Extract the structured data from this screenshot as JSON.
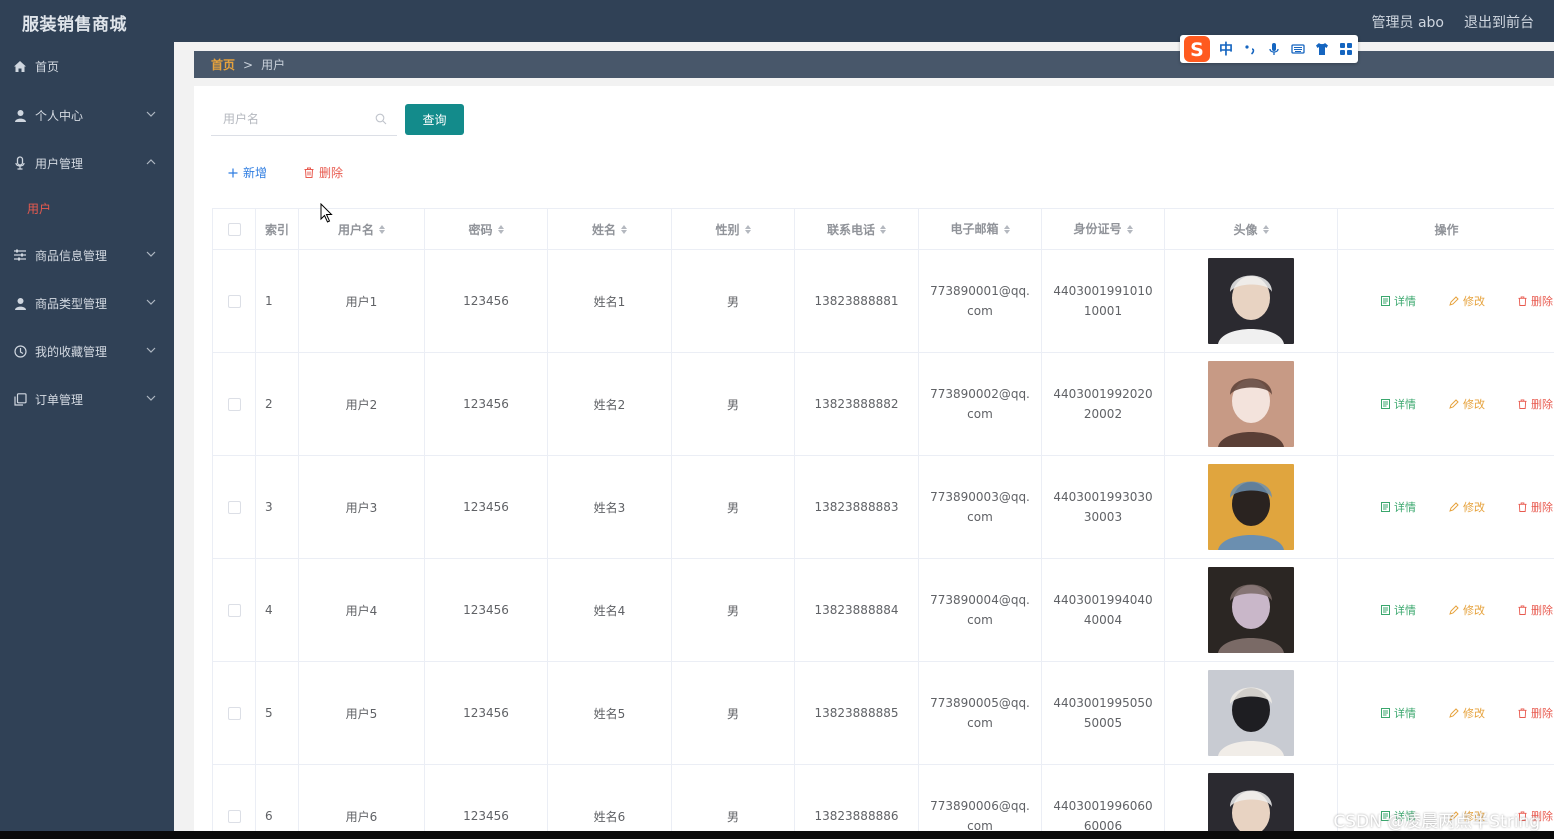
{
  "app": {
    "brand": "服装销售商城",
    "admin": "管理员 abo",
    "exit": "退出到前台"
  },
  "sidebar": {
    "items": [
      {
        "label": "首页",
        "icon": "home-icon"
      },
      {
        "label": "个人中心",
        "icon": "user-icon"
      },
      {
        "label": "用户管理",
        "icon": "mic-icon"
      },
      {
        "label": "用户",
        "icon": ""
      },
      {
        "label": "商品信息管理",
        "icon": "sliders-icon"
      },
      {
        "label": "商品类型管理",
        "icon": "user-icon"
      },
      {
        "label": "我的收藏管理",
        "icon": "clock-icon"
      },
      {
        "label": "订单管理",
        "icon": "copy-icon"
      }
    ]
  },
  "breadcrumb": {
    "home": "首页",
    "sep": ">",
    "current": "用户"
  },
  "search": {
    "placeholder": "用户名",
    "button": "查询"
  },
  "actions": {
    "add": "新增",
    "delete": "删除"
  },
  "table": {
    "headers": {
      "index": "索引",
      "username": "用户名",
      "password": "密码",
      "name": "姓名",
      "gender": "性别",
      "phone": "联系电话",
      "email": "电子邮箱",
      "idcard": "身份证号",
      "avatar": "头像",
      "ops": "操作"
    },
    "op_labels": {
      "detail": "详情",
      "edit": "修改",
      "delete": "删除"
    },
    "rows": [
      {
        "index": "1",
        "username": "用户1",
        "password": "123456",
        "name": "姓名1",
        "gender": "男",
        "phone": "13823888881",
        "email": "773890001@qq.com",
        "idcard": "440300199101010001"
      },
      {
        "index": "2",
        "username": "用户2",
        "password": "123456",
        "name": "姓名2",
        "gender": "男",
        "phone": "13823888882",
        "email": "773890002@qq.com",
        "idcard": "440300199202020002"
      },
      {
        "index": "3",
        "username": "用户3",
        "password": "123456",
        "name": "姓名3",
        "gender": "男",
        "phone": "13823888883",
        "email": "773890003@qq.com",
        "idcard": "440300199303030003"
      },
      {
        "index": "4",
        "username": "用户4",
        "password": "123456",
        "name": "姓名4",
        "gender": "男",
        "phone": "13823888884",
        "email": "773890004@qq.com",
        "idcard": "440300199404040004"
      },
      {
        "index": "5",
        "username": "用户5",
        "password": "123456",
        "name": "姓名5",
        "gender": "男",
        "phone": "13823888885",
        "email": "773890005@qq.com",
        "idcard": "440300199505050005"
      },
      {
        "index": "6",
        "username": "用户6",
        "password": "123456",
        "name": "姓名6",
        "gender": "男",
        "phone": "13823888886",
        "email": "773890006@qq.com",
        "idcard": "440300199606060006"
      }
    ]
  },
  "ime": {
    "lang": "中"
  },
  "watermark": "CSDN @凌晨两点半String",
  "colors": {
    "sidebar": "#304156",
    "primary_button": "#138b8b",
    "active_menu": "#e85a4f",
    "breadcrumb_home": "#e6a23c"
  }
}
